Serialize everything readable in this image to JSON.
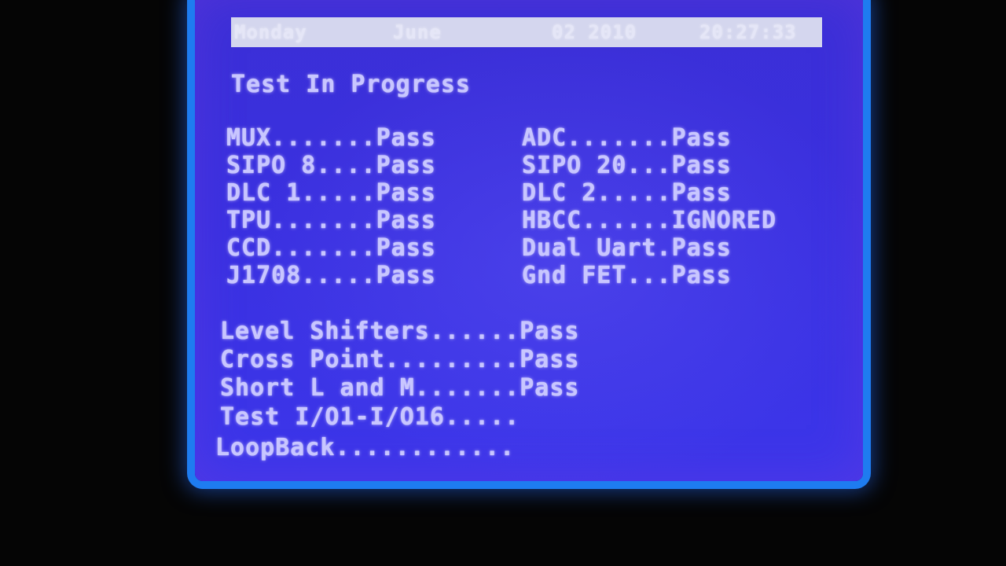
{
  "status_bar": {
    "day": "Monday",
    "month": "June",
    "date": "02 2010",
    "time": "20:27:33"
  },
  "heading": "Test In Progress",
  "tests_left": [
    "MUX.......Pass",
    "SIPO 8....Pass",
    "DLC 1.....Pass",
    "TPU.......Pass",
    "CCD.......Pass",
    "J1708.....Pass"
  ],
  "tests_right": [
    "ADC.......Pass",
    "SIPO 20...Pass",
    "DLC 2.....Pass",
    "HBCC......IGNORED",
    "Dual Uart.Pass",
    "Gnd FET...Pass"
  ],
  "tests_bottom": [
    "Level Shifters......Pass",
    "Cross Point.........Pass",
    "Short L and M.......Pass",
    "Test I/O1-I/O16.....",
    "LoopBack............"
  ]
}
